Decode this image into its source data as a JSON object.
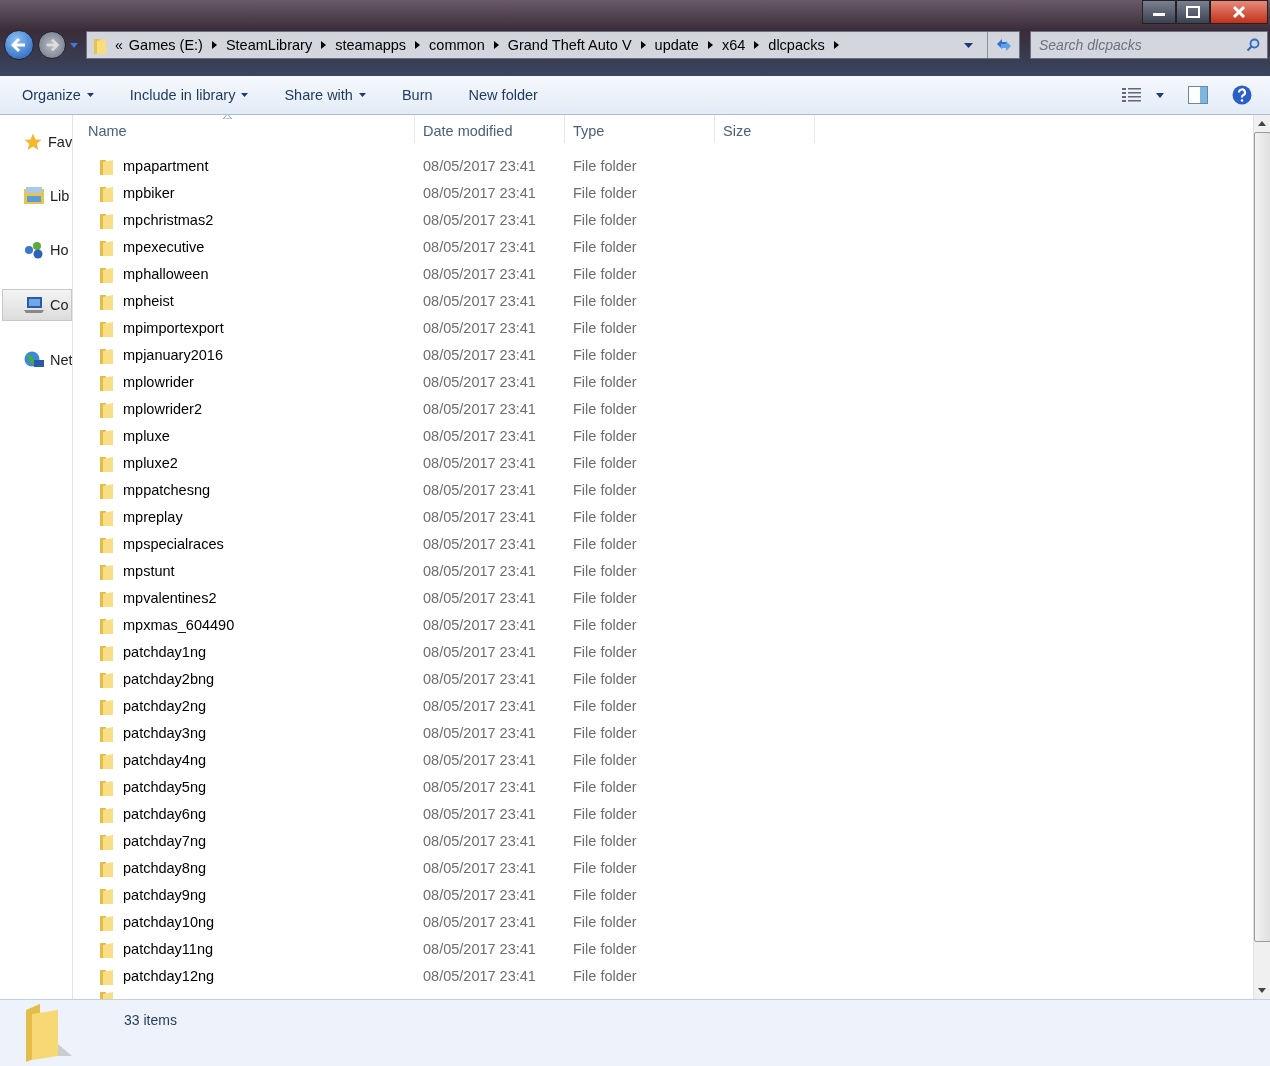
{
  "address_bar": {
    "overflow": "«",
    "crumbs": [
      "Games (E:)",
      "SteamLibrary",
      "steamapps",
      "common",
      "Grand Theft Auto V",
      "update",
      "x64",
      "dlcpacks"
    ]
  },
  "search": {
    "placeholder": "Search dlcpacks"
  },
  "toolbar": [
    {
      "label": "Organize",
      "dropdown": true
    },
    {
      "label": "Include in library",
      "dropdown": true
    },
    {
      "label": "Share with",
      "dropdown": true
    },
    {
      "label": "Burn",
      "dropdown": false
    },
    {
      "label": "New folder",
      "dropdown": false
    }
  ],
  "sidebar": {
    "items": [
      {
        "label": "Fav",
        "kind": "star",
        "selected": false
      },
      {
        "label": "Lib",
        "kind": "library",
        "selected": false
      },
      {
        "label": "Ho",
        "kind": "homegroup",
        "selected": false
      },
      {
        "label": "Co",
        "kind": "computer",
        "selected": true
      },
      {
        "label": "Net",
        "kind": "network",
        "selected": false
      }
    ]
  },
  "table": {
    "columns": [
      "Name",
      "Date modified",
      "Type",
      "Size"
    ],
    "rows": [
      [
        "mpapartment",
        "08/05/2017 23:41",
        "File folder"
      ],
      [
        "mpbiker",
        "08/05/2017 23:41",
        "File folder"
      ],
      [
        "mpchristmas2",
        "08/05/2017 23:41",
        "File folder"
      ],
      [
        "mpexecutive",
        "08/05/2017 23:41",
        "File folder"
      ],
      [
        "mphalloween",
        "08/05/2017 23:41",
        "File folder"
      ],
      [
        "mpheist",
        "08/05/2017 23:41",
        "File folder"
      ],
      [
        "mpimportexport",
        "08/05/2017 23:41",
        "File folder"
      ],
      [
        "mpjanuary2016",
        "08/05/2017 23:41",
        "File folder"
      ],
      [
        "mplowrider",
        "08/05/2017 23:41",
        "File folder"
      ],
      [
        "mplowrider2",
        "08/05/2017 23:41",
        "File folder"
      ],
      [
        "mpluxe",
        "08/05/2017 23:41",
        "File folder"
      ],
      [
        "mpluxe2",
        "08/05/2017 23:41",
        "File folder"
      ],
      [
        "mppatchesng",
        "08/05/2017 23:41",
        "File folder"
      ],
      [
        "mpreplay",
        "08/05/2017 23:41",
        "File folder"
      ],
      [
        "mpspecialraces",
        "08/05/2017 23:41",
        "File folder"
      ],
      [
        "mpstunt",
        "08/05/2017 23:41",
        "File folder"
      ],
      [
        "mpvalentines2",
        "08/05/2017 23:41",
        "File folder"
      ],
      [
        "mpxmas_604490",
        "08/05/2017 23:41",
        "File folder"
      ],
      [
        "patchday1ng",
        "08/05/2017 23:41",
        "File folder"
      ],
      [
        "patchday2bng",
        "08/05/2017 23:41",
        "File folder"
      ],
      [
        "patchday2ng",
        "08/05/2017 23:41",
        "File folder"
      ],
      [
        "patchday3ng",
        "08/05/2017 23:41",
        "File folder"
      ],
      [
        "patchday4ng",
        "08/05/2017 23:41",
        "File folder"
      ],
      [
        "patchday5ng",
        "08/05/2017 23:41",
        "File folder"
      ],
      [
        "patchday6ng",
        "08/05/2017 23:41",
        "File folder"
      ],
      [
        "patchday7ng",
        "08/05/2017 23:41",
        "File folder"
      ],
      [
        "patchday8ng",
        "08/05/2017 23:41",
        "File folder"
      ],
      [
        "patchday9ng",
        "08/05/2017 23:41",
        "File folder"
      ],
      [
        "patchday10ng",
        "08/05/2017 23:41",
        "File folder"
      ],
      [
        "patchday11ng",
        "08/05/2017 23:41",
        "File folder"
      ],
      [
        "patchday12ng",
        "08/05/2017 23:41",
        "File folder"
      ]
    ]
  },
  "status_bar": {
    "count": "33 items"
  }
}
